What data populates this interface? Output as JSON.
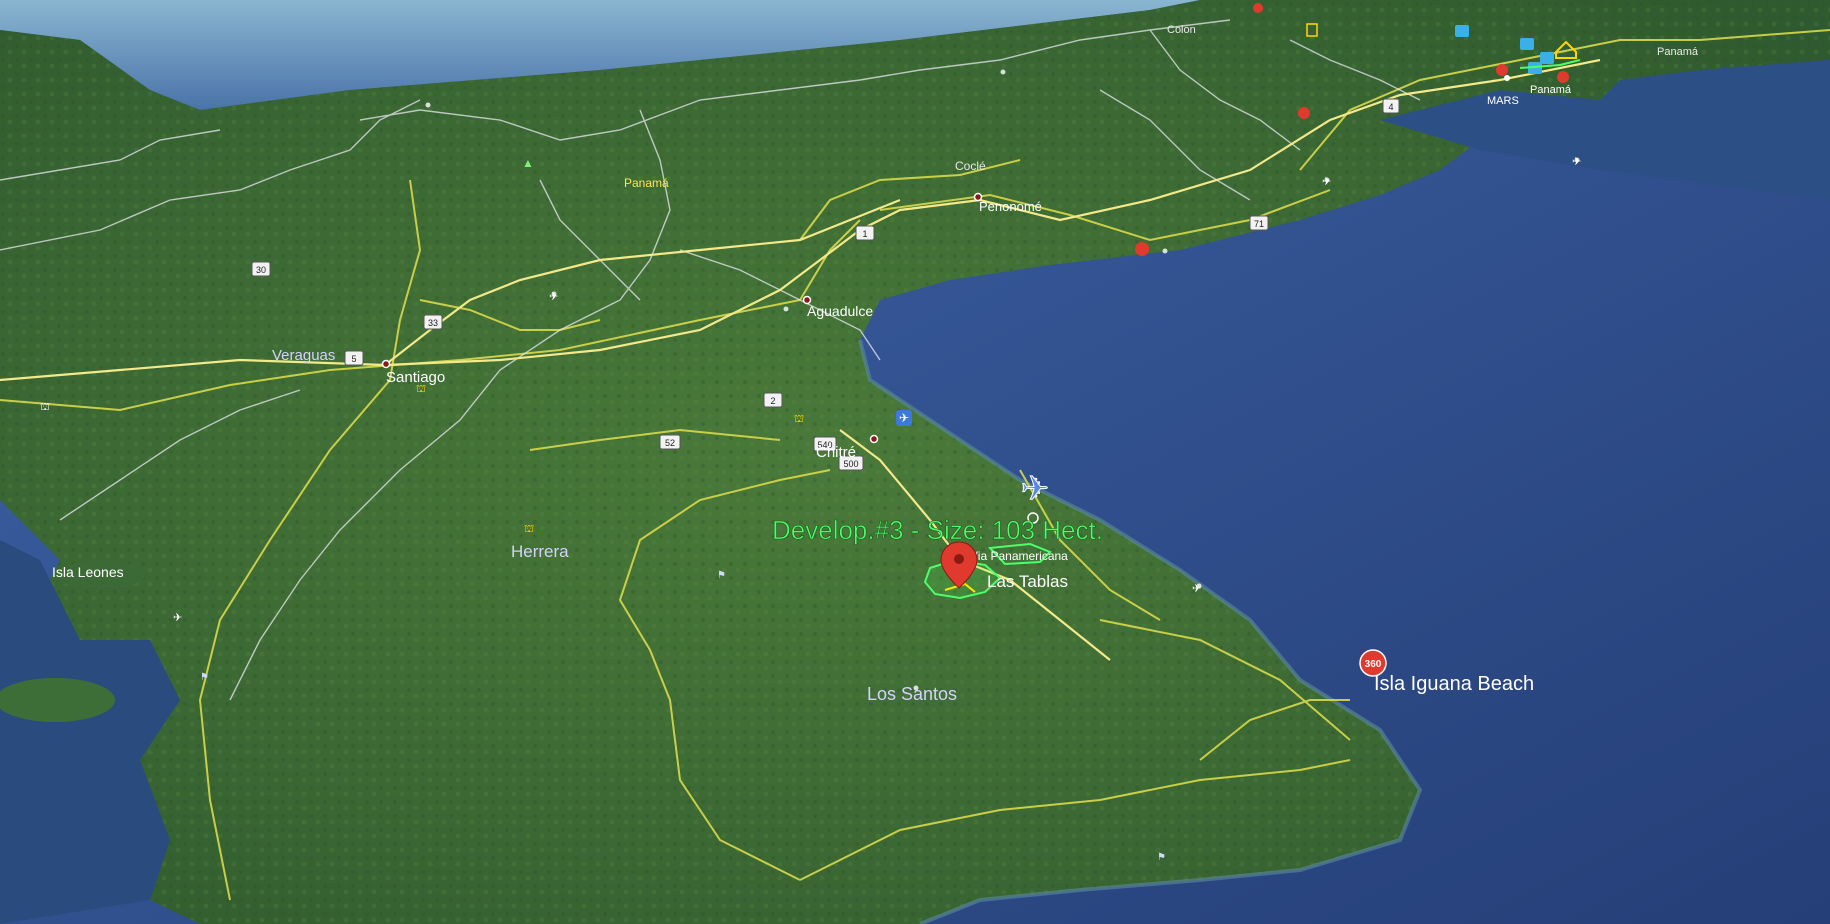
{
  "map": {
    "places": {
      "colon": "Colon",
      "panama_top": "Panamá",
      "panama_prov": "Panamá",
      "panama_city": "Panamá",
      "mars": "MARS",
      "cocle": "Coclé",
      "penonome": "Penonomé",
      "aguadulce": "Aguadulce",
      "veraguas": "Veraguas",
      "santiago": "Santiago",
      "chitre": "Chitré",
      "herrera": "Herrera",
      "isla_leones": "Isla Leones",
      "los_santos": "Los Santos",
      "las_tablas": "Las Tablas",
      "via_panamericana": "Via Panamericana",
      "isla_iguana": "Isla Iguana Beach"
    },
    "development_label": "Develop.#3 - Size: 103 Hect.",
    "route_shields": {
      "r1": "1",
      "r2": "2",
      "r4": "4",
      "r5": "5",
      "r30": "30",
      "r33": "33",
      "r52": "52",
      "r71": "71",
      "r500": "500",
      "r540": "540"
    },
    "badge_360": "360",
    "colors": {
      "land": "#3d6a35",
      "water": "#2e4f88",
      "border_lines": "#d9d94a",
      "road_lines": "#e8e8f0",
      "development_label": "#4cff6a",
      "marker": "#e03a2e"
    },
    "icons": [
      "placemark-icon",
      "airport-icon",
      "360-photo-icon",
      "home-icon",
      "photo-icon"
    ]
  }
}
